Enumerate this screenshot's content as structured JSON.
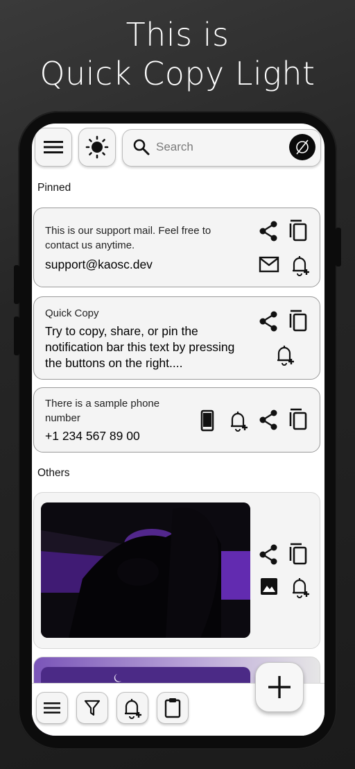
{
  "promo": {
    "line1": "This is",
    "line2": "Quick Copy Light"
  },
  "search": {
    "placeholder": "Search"
  },
  "sections": {
    "pinned": "Pinned",
    "others": "Others"
  },
  "pinned_cards": [
    {
      "label": "This is our support mail. Feel free to contact us anytime.",
      "value": "support@kaosc.dev"
    },
    {
      "label": "Quick Copy",
      "value": "Try to copy, share, or pin the notification bar this text by pressing the buttons on the right...."
    },
    {
      "label": "There is a sample phone number",
      "value": "+1 234 567 89 00"
    }
  ],
  "icons": {
    "menu": "menu-icon",
    "theme": "brightness-icon",
    "search": "search-icon",
    "clear": "clear-icon",
    "share": "share-icon",
    "copy": "copy-icon",
    "email": "email-icon",
    "pin": "notification-add-icon",
    "phone": "phone-icon",
    "image": "image-icon",
    "filter": "filter-icon",
    "clipboard": "clipboard-icon",
    "add": "plus-icon"
  },
  "colors": {
    "background": "#1f1f1f",
    "screen": "#ffffff",
    "card": "#f4f4f4",
    "accent_purple": "#8a3fd1"
  }
}
